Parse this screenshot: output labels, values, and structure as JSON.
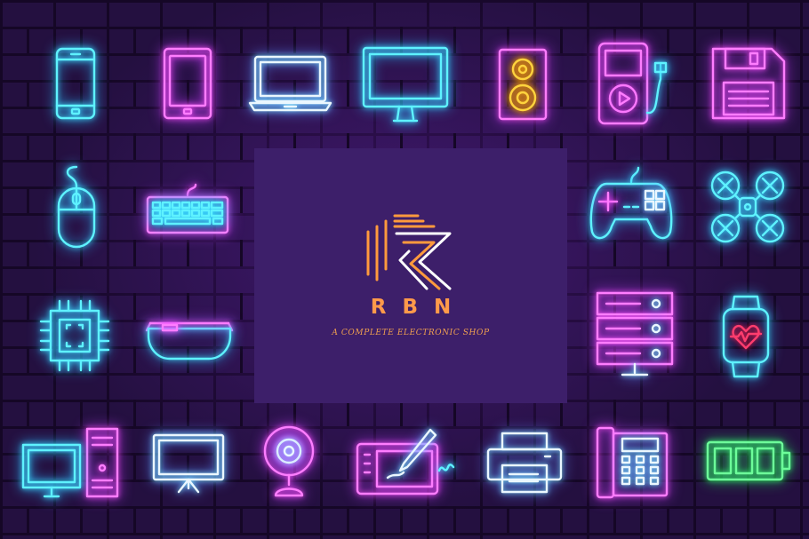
{
  "brand": {
    "name": "RBN",
    "tagline": "A COMPLETE ELECTRONIC SHOP",
    "accent_color": "#ff9a4a",
    "panel_color": "#3d1f6a"
  },
  "icons": [
    "smartphone-icon",
    "tablet-icon",
    "laptop-icon",
    "monitor-icon",
    "speaker-icon",
    "mp3-player-icon",
    "floppy-disk-icon",
    "mouse-icon",
    "keyboard-icon",
    "gamepad-icon",
    "drone-icon",
    "cpu-chip-icon",
    "smart-glasses-icon",
    "server-icon",
    "smartwatch-icon",
    "desktop-computer-icon",
    "tv-icon",
    "webcam-icon",
    "graphics-tablet-icon",
    "printer-icon",
    "telephone-icon",
    "battery-icon"
  ],
  "colors": {
    "background": "#241040",
    "neon_cyan": "#5ef2ff",
    "neon_pink": "#ff7dff",
    "neon_yellow": "#ffd33d",
    "neon_green": "#6dff9a"
  }
}
